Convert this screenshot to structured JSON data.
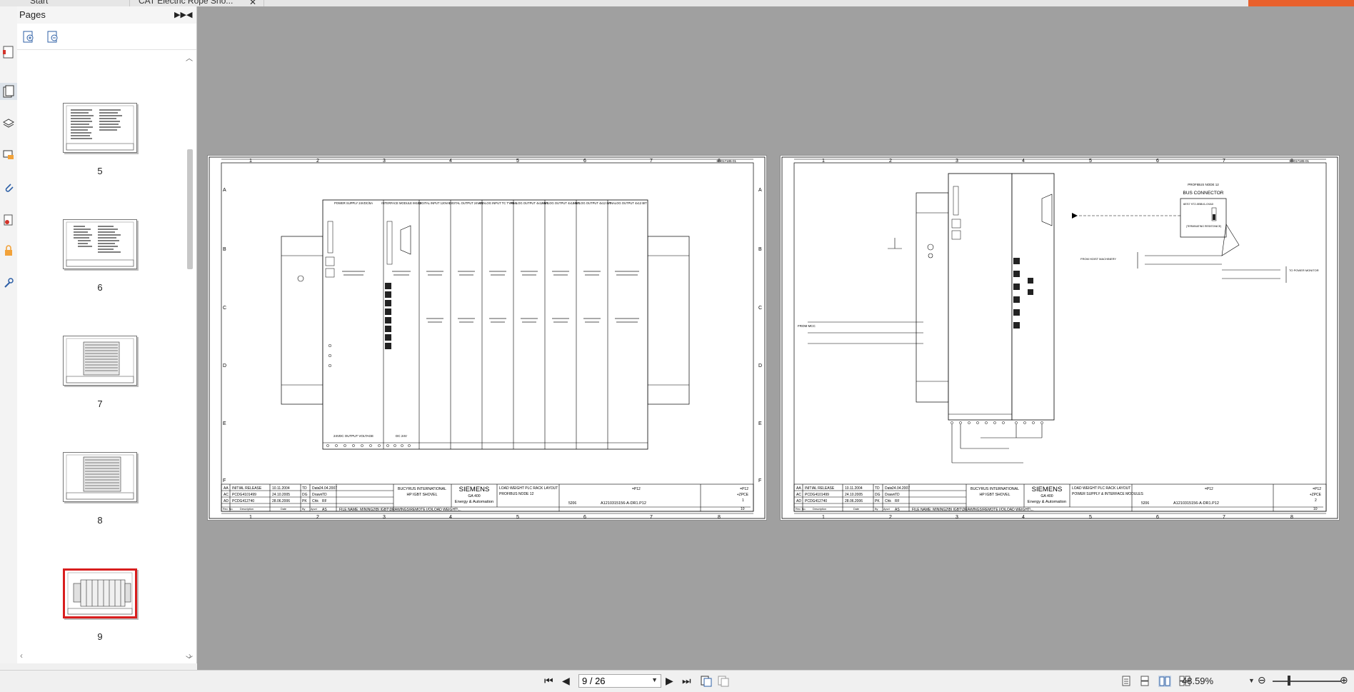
{
  "tabs": [
    {
      "label": "Start"
    },
    {
      "label": "CAT Electric Rope Sho..."
    }
  ],
  "sidebar_icons": [
    "page-thumbnail-icon",
    "pages-icon",
    "layers-icon",
    "comments-icon",
    "attachment-icon",
    "signature-icon",
    "security-icon",
    "tools-icon"
  ],
  "pages_panel": {
    "title": "Pages",
    "expand_icon": "double-chevron-right-icon",
    "collapse_icon": "chevron-left-icon",
    "toolbar_icons": [
      "zoom-in-thumbnails-icon",
      "zoom-out-thumbnails-icon"
    ],
    "thumbnails": [
      {
        "label": "5",
        "selected": false
      },
      {
        "label": "6",
        "selected": false
      },
      {
        "label": "7",
        "selected": false
      },
      {
        "label": "8",
        "selected": false
      },
      {
        "label": "9",
        "selected": true
      }
    ]
  },
  "document": {
    "left_page": {
      "sheet_no": "SH017185-01",
      "title_block": {
        "company": "BUCYRUS INTERNATIONAL",
        "machine": "HP IGBT SHOVEL",
        "brand": "SIEMENS",
        "brand_sub": "GA 400",
        "brand_sub2": "Energy & Automation",
        "drawing_title_1": "LOAD WEIGHT PLC RACK LAYOUT",
        "drawing_title_2": "PROFIBUS NODE 12",
        "drawing_number": "A1210315156-A-DR1.P12",
        "sheet": "1",
        "of": "10",
        "code": "5206",
        "ref": "=P12",
        "loc": "+ZPCE"
      },
      "modules": [
        "POWER SUPPLY 24VDC/5A",
        "INTERFACE MODULE IM153",
        "DIGITAL INPUT 120VAC",
        "DIGITAL OUTPUT 24VDC",
        "ANALOG INPUT TC TYPE J",
        "ANALOG OUTPUT 4x12 BIT",
        "ANALOG OUTPUT 4x12 BIT",
        "ANALOG OUTPUT 4x12 BIT",
        "ANALOG OUTPUT 4x12 BIT"
      ],
      "footer_left": "24VDC OUTPUT VOLTAGE",
      "footer_right": "DC 24V",
      "file_name": "FILE NAME: MINING2\\BI IGBT\\DRAWINGS\\REMOTE I/O\\LOAD WEIGHT\\..."
    },
    "right_page": {
      "sheet_no": "SH017185-01",
      "title_block": {
        "company": "BUCYRUS INTERNATIONAL",
        "machine": "HP IGBT SHOVEL",
        "brand": "SIEMENS",
        "brand_sub": "GA 400",
        "brand_sub2": "Energy & Automation",
        "drawing_title_1": "LOAD WEIGHT PLC RACK LAYOUT",
        "drawing_title_2": "POWER SUPPLY & INTERFACE MODULES",
        "drawing_number": "A1210315156-A-DR1.P12",
        "sheet": "2",
        "of": "10",
        "code": "5206",
        "ref": "=P12",
        "loc": "+ZPCE"
      },
      "bus_connector_title": "PROFIBUS NODE 12",
      "bus_connector_label": "BUS CONNECTOR",
      "bus_connector_part": "6ES7 972-0BB41-0XA0",
      "bus_connector_note": "(TERMINATING RESISTANCE)",
      "from_label": "FROM HOIST MACHINERY",
      "to_label": "TO POWER MONITOR",
      "from_mcc": "FROM MCC"
    },
    "revisions": [
      {
        "rev": "AA",
        "desc": "INITIAL RELEASE",
        "date": "10.11.2004",
        "by": "TD"
      },
      {
        "rev": "AC",
        "desc": "PCDG4101499",
        "date": "24.10.2005",
        "by": "DG"
      },
      {
        "rev": "AD",
        "desc": "PCDG412740",
        "date": "28.06.2006",
        "by": "PK"
      }
    ],
    "rev_header": {
      "rev": "Rev. No.",
      "desc": "Description",
      "date": "Date",
      "by": "By",
      "appd": "Apvd"
    },
    "date_label": "Date",
    "date_value": "24.04.2007",
    "drawn_label": "Drawn",
    "drawn_value": "TD",
    "chk_label": "Chk",
    "chk_value": "RF",
    "appd_value": "AS",
    "column_numbers": [
      "1",
      "2",
      "3",
      "4",
      "5",
      "6",
      "7",
      "8"
    ],
    "row_letters": [
      "A",
      "B",
      "C",
      "D",
      "E",
      "F"
    ]
  },
  "statusbar": {
    "page_value": "9 / 26",
    "zoom": "48.59%",
    "nav_icons": [
      "first-page-icon",
      "previous-page-icon",
      "next-page-icon",
      "last-page-icon"
    ],
    "view_icons": [
      "single-page-icon",
      "continuous-icon",
      "facing-icon",
      "continuous-facing-icon"
    ]
  }
}
